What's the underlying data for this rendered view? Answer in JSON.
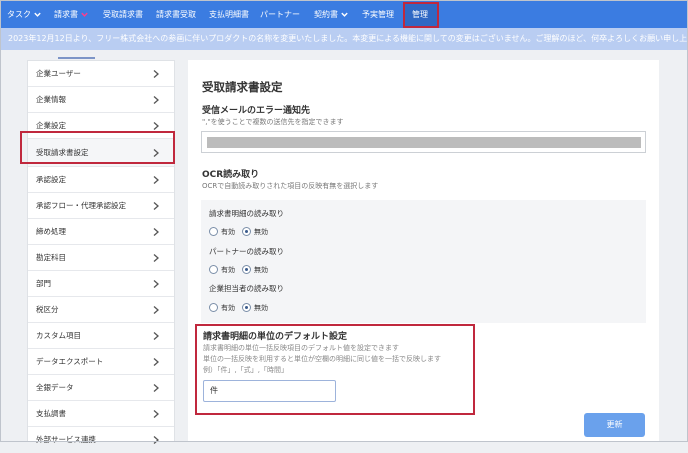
{
  "nav": {
    "items": [
      {
        "label": "タスク",
        "chevron": true
      },
      {
        "label": "請求書",
        "chevron": true
      },
      {
        "label": "受取請求書",
        "chevron": false
      },
      {
        "label": "請求書受取",
        "chevron": false
      },
      {
        "label": "支払明細書",
        "chevron": false
      },
      {
        "label": "パートナー",
        "chevron": false
      },
      {
        "label": "契約書",
        "chevron": true
      },
      {
        "label": "予実管理",
        "chevron": false
      },
      {
        "label": "管理",
        "chevron": false
      }
    ],
    "active": "管理",
    "colors": {
      "bar": "#3b7ce1",
      "highlight": "#c0283d"
    }
  },
  "announcement": {
    "text": "2023年12月12日より、フリー株式会社への参画に伴いプロダクトの名称を変更いたしました。本変更による機能に関しての変更はございません。ご理解のほど、何卒よろしくお願い申し上げます。"
  },
  "sidebar": {
    "items": [
      {
        "label": "企業ユーザー"
      },
      {
        "label": "企業情報"
      },
      {
        "label": "企業設定"
      },
      {
        "label": "受取請求書設定"
      },
      {
        "label": "承認設定"
      },
      {
        "label": "承認フロー・代理承認設定"
      },
      {
        "label": "締め処理"
      },
      {
        "label": "勘定科目"
      },
      {
        "label": "部門"
      },
      {
        "label": "税区分"
      },
      {
        "label": "カスタム項目"
      },
      {
        "label": "データエクスポート"
      },
      {
        "label": "全銀データ"
      },
      {
        "label": "支払調書"
      },
      {
        "label": "外部サービス連携"
      }
    ],
    "active": "受取請求書設定"
  },
  "main": {
    "title": "受取請求書設定",
    "email_section": {
      "title": "受信メールのエラー通知先",
      "desc": "\",\"を使うことで複数の送信先を指定できます"
    },
    "ocr_section": {
      "title": "OCR読み取り",
      "desc": "OCRで自動読み取りされた項目の反映有無を選択します",
      "groups": [
        {
          "label": "請求書明細の読み取り",
          "options": [
            "有効",
            "無効"
          ],
          "selected": "無効"
        },
        {
          "label": "パートナーの読み取り",
          "options": [
            "有効",
            "無効"
          ],
          "selected": "無効"
        },
        {
          "label": "企業担当者の読み取り",
          "options": [
            "有効",
            "無効"
          ],
          "selected": "無効"
        }
      ]
    },
    "unit_section": {
      "title": "請求書明細の単位のデフォルト設定",
      "desc1": "請求書明細の単位一括反映項目のデフォルト値を設定できます",
      "desc2": "単位の一括反映を利用すると単位が空欄の明細に同じ値を一括で反映します",
      "example": "例）「件」,「式」,「時間」",
      "value": "件"
    },
    "update_button": "更新"
  }
}
